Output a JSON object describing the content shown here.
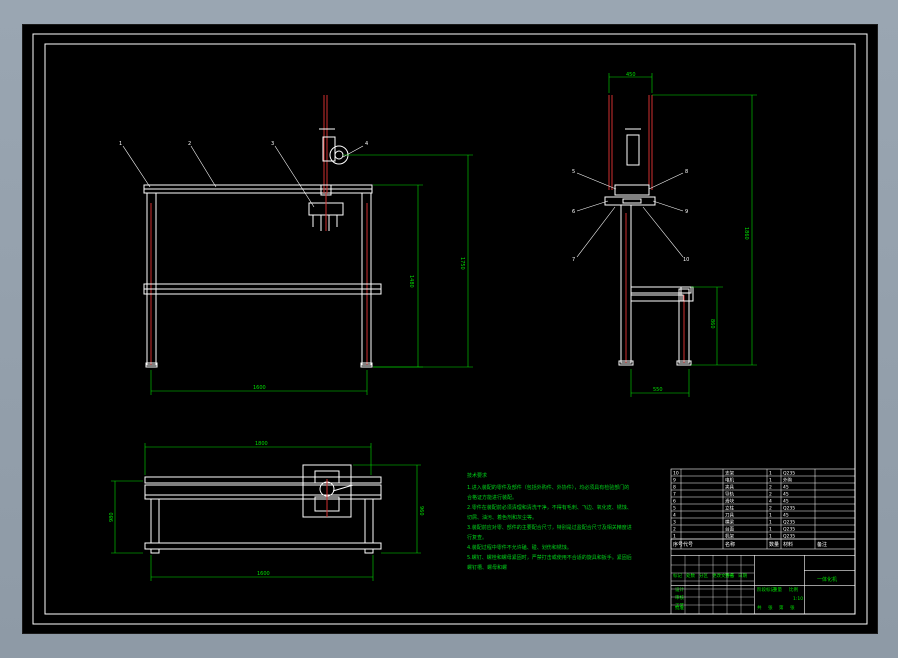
{
  "drawing_title": "一体化机",
  "colors": {
    "background": "#000000",
    "frame": "#ffffff",
    "dimension": "#00e000",
    "accent_red": "#d03030",
    "note_text": "#00d21a"
  },
  "front_view": {
    "callouts": [
      "1",
      "2",
      "3",
      "4"
    ],
    "dim_width": "1600",
    "dim_height_inner": "1480",
    "dim_height_outer": "1750"
  },
  "side_view": {
    "dim_top": "450",
    "dim_width": "550",
    "dim_height": "1860",
    "dim_table": "860",
    "callouts_left": [
      "5",
      "6",
      "7"
    ],
    "callouts_right": [
      "8",
      "9",
      "10"
    ]
  },
  "top_view": {
    "dim_width": "1800",
    "dim_bottom": "1600",
    "dim_depth_left": "980",
    "dim_depth_right": "960"
  },
  "notes": {
    "title": "技术要求",
    "lines": [
      "1.进入装配的零件及部件（包括外购件、外协件），均必须具有检验部门的",
      "合格证方能进行装配。",
      "2.零件在装配前必须清理和清洗干净，不得有毛刺、飞边、氧化皮、锈蚀、",
      "切屑、油污、着色剂和灰尘等。",
      "3.装配前应对零、部件的主要配合尺寸，特别是过盈配合尺寸及相关精度进",
      "行复查。",
      "4.装配过程中零件不允许磕、碰、划伤和锈蚀。",
      "5.螺钉、螺栓和螺母紧固时，严禁打击或使用不合适的旋具和扳手。紧固后",
      "螺钉槽、螺母和螺"
    ]
  },
  "title_block": {
    "parts_rows": [
      {
        "no": "10",
        "name": "支架",
        "qty": "1",
        "material": "Q235"
      },
      {
        "no": "9",
        "name": "电机",
        "qty": "1",
        "material": "外购"
      },
      {
        "no": "8",
        "name": "夹具",
        "qty": "2",
        "material": "45"
      },
      {
        "no": "7",
        "name": "导轨",
        "qty": "2",
        "material": "45"
      },
      {
        "no": "6",
        "name": "滑块",
        "qty": "4",
        "material": "45"
      },
      {
        "no": "5",
        "name": "立柱",
        "qty": "2",
        "material": "Q235"
      },
      {
        "no": "4",
        "name": "刀具",
        "qty": "1",
        "material": "45"
      },
      {
        "no": "3",
        "name": "横梁",
        "qty": "1",
        "material": "Q235"
      },
      {
        "no": "2",
        "name": "台面",
        "qty": "1",
        "material": "Q235"
      },
      {
        "no": "1",
        "name": "机架",
        "qty": "1",
        "material": "Q235"
      }
    ],
    "headers": [
      "序号",
      "代号",
      "名称",
      "数量",
      "材料",
      "备注"
    ],
    "sign_labels": [
      "标记",
      "处数",
      "分区",
      "更改文件号",
      "签名",
      "日期"
    ],
    "sign_labels_2": [
      "设计",
      "审核",
      "工艺"
    ],
    "scale_labels": [
      "阶段标记",
      "重量",
      "比例"
    ],
    "scale_value": "1:10",
    "sheet_labels": [
      "共",
      "张",
      "第",
      "张"
    ],
    "approve_label": "批准"
  }
}
